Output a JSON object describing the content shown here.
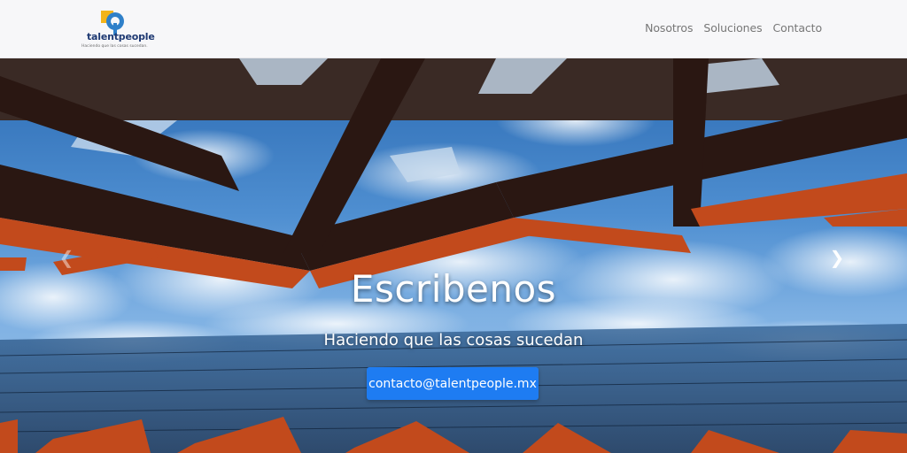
{
  "brand": {
    "name": "talentpeople",
    "tagline": "Haciendo que las cosas sucedan."
  },
  "nav": {
    "items": [
      "Nosotros",
      "Soluciones",
      "Contacto"
    ]
  },
  "hero": {
    "headline": "Escribenos",
    "subtitle": "Haciendo que las cosas sucedan",
    "cta_label": "contacto@talentpeople.mx",
    "prev_icon": "chevron-left-icon",
    "next_icon": "chevron-right-icon"
  },
  "colors": {
    "cta": "#1e7cf2",
    "sky": "#4f8fd1",
    "beam_rust": "#c24a1c",
    "beam_dark": "#2a1712",
    "nav_text": "#777777"
  }
}
